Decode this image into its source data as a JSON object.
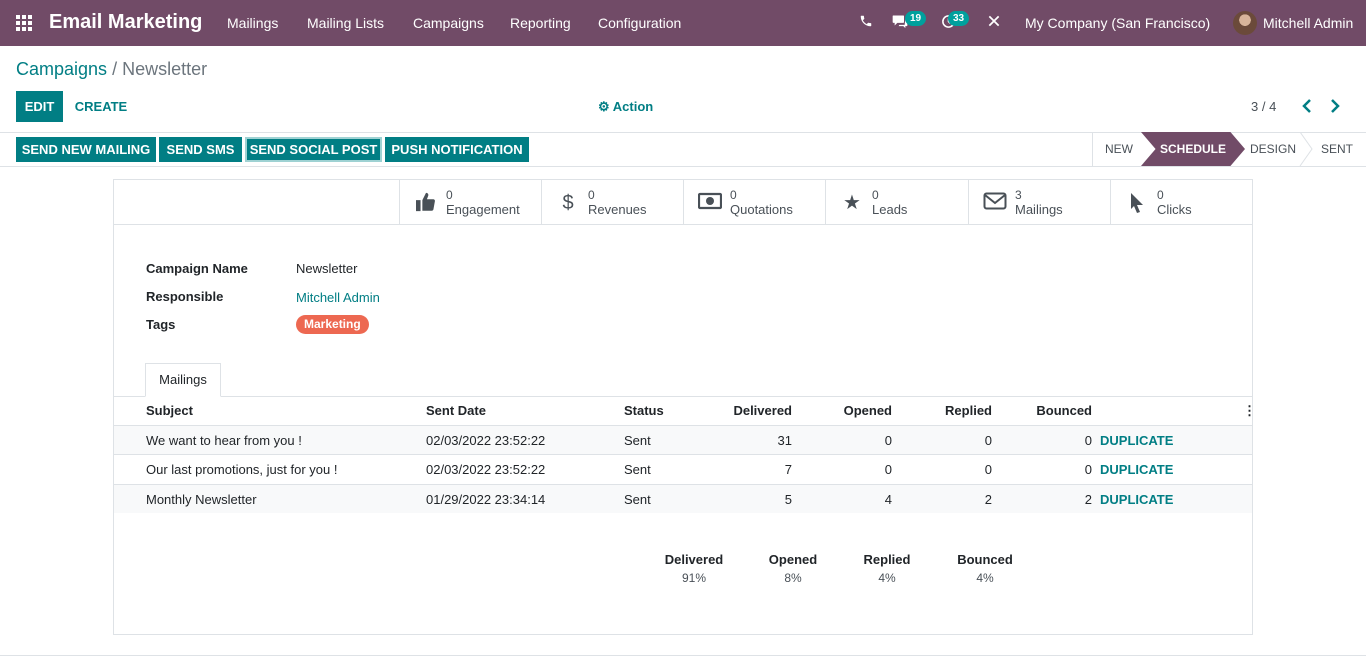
{
  "navbar": {
    "app_name": "Email Marketing",
    "menu": [
      "Mailings",
      "Mailing Lists",
      "Campaigns",
      "Reporting",
      "Configuration"
    ],
    "messages_count": "19",
    "activities_count": "33",
    "company": "My Company (San Francisco)",
    "user": "Mitchell Admin",
    "icons": [
      "apps-grid-icon",
      "phone-icon",
      "chat-icon",
      "clock-icon",
      "debug-tools-icon"
    ]
  },
  "breadcrumb": {
    "parent": "Campaigns",
    "separator": "/",
    "current": "Newsletter"
  },
  "control": {
    "edit": "Edit",
    "create": "Create",
    "action": "Action",
    "pager": "3 / 4"
  },
  "header_buttons": [
    "Send New Mailing",
    "Send SMS",
    "Send Social Post",
    "Push Notification"
  ],
  "stages": [
    "New",
    "Schedule",
    "Design",
    "Sent"
  ],
  "current_stage": "Schedule",
  "smart_buttons": [
    {
      "value": "0",
      "label": "Engagement",
      "icon": "thumbs-up-icon"
    },
    {
      "value": "0",
      "label": "Revenues",
      "icon": "dollar-icon"
    },
    {
      "value": "0",
      "label": "Quotations",
      "icon": "money-icon"
    },
    {
      "value": "0",
      "label": "Leads",
      "icon": "star-icon"
    },
    {
      "value": "3",
      "label": "Mailings",
      "icon": "envelope-icon"
    },
    {
      "value": "0",
      "label": "Clicks",
      "icon": "cursor-icon"
    }
  ],
  "form": {
    "campaign_name_label": "Campaign Name",
    "campaign_name": "Newsletter",
    "responsible_label": "Responsible",
    "responsible": "Mitchell Admin",
    "tags_label": "Tags",
    "tag": "Marketing"
  },
  "tab": "Mailings",
  "table": {
    "columns": [
      "Subject",
      "Sent Date",
      "Status",
      "Delivered",
      "Opened",
      "Replied",
      "Bounced"
    ],
    "rows": [
      {
        "subject": "We want to hear from you !",
        "date": "02/03/2022 23:52:22",
        "status": "Sent",
        "delivered": "31",
        "opened": "0",
        "replied": "0",
        "bounced": "0"
      },
      {
        "subject": "Our last promotions, just for you !",
        "date": "02/03/2022 23:52:22",
        "status": "Sent",
        "delivered": "7",
        "opened": "0",
        "replied": "0",
        "bounced": "0"
      },
      {
        "subject": "Monthly Newsletter",
        "date": "01/29/2022 23:34:14",
        "status": "Sent",
        "delivered": "5",
        "opened": "4",
        "replied": "2",
        "bounced": "2"
      }
    ],
    "row_button": "Duplicate"
  },
  "totals": [
    {
      "label": "Delivered",
      "value": "91%"
    },
    {
      "label": "Opened",
      "value": "8%"
    },
    {
      "label": "Replied",
      "value": "4%"
    },
    {
      "label": "Bounced",
      "value": "4%"
    }
  ],
  "colors": {
    "brand": "#714B67",
    "accent": "#017E84",
    "tag": "#ED6851",
    "badge": "#00A09D"
  }
}
